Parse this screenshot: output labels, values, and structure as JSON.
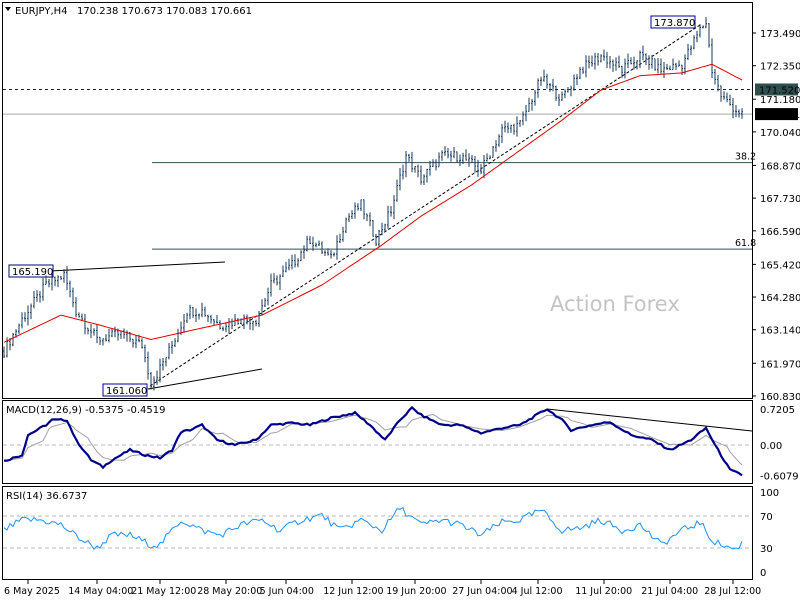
{
  "header": {
    "symbol": "EURJPY,H4",
    "ohlc": "170.238 170.673 170.083 170.661"
  },
  "watermark": "Action Forex",
  "colors": {
    "bars": "#1a3a5a",
    "ma": "#e00000",
    "macd": "#00008b",
    "signal": "#a0a0a0",
    "rsi": "#1e90ff"
  },
  "chart_data": [
    {
      "type": "line",
      "name": "price",
      "title": "EURJPY,H4",
      "bar_count": 247,
      "yticks": [
        "173.490",
        "172.350",
        "171.180",
        "170.040",
        "168.870",
        "167.730",
        "166.590",
        "165.420",
        "164.280",
        "163.140",
        "161.970",
        "160.830"
      ],
      "ytick_values": [
        173.49,
        172.35,
        171.18,
        170.04,
        168.87,
        167.73,
        166.59,
        165.42,
        164.28,
        163.14,
        161.97,
        160.83
      ],
      "ylim": [
        160.83,
        174.6
      ],
      "xticks": [
        {
          "label": "6 May 2025",
          "bar": 8
        },
        {
          "label": "14 May 04:00",
          "bar": 31
        },
        {
          "label": "21 May 12:00",
          "bar": 52
        },
        {
          "label": "28 May 20:00",
          "bar": 74
        },
        {
          "label": "5 Jun 04:00",
          "bar": 94
        },
        {
          "label": "12 Jun 12:00",
          "bar": 116
        },
        {
          "label": "19 Jun 20:00",
          "bar": 137
        },
        {
          "label": "27 Jun 04:00",
          "bar": 159
        },
        {
          "label": "4 Jul 12:00",
          "bar": 178
        },
        {
          "label": "11 Jul 20:00",
          "bar": 200
        },
        {
          "label": "21 Jul 04:00",
          "bar": 222
        },
        {
          "label": "28 Jul 12:00",
          "bar": 243
        }
      ],
      "close_path": [
        [
          0,
          162.4
        ],
        [
          6,
          163.5
        ],
        [
          14,
          164.7
        ],
        [
          20,
          165.05
        ],
        [
          24,
          163.8
        ],
        [
          31,
          162.8
        ],
        [
          39,
          163.0
        ],
        [
          46,
          162.6
        ],
        [
          49,
          161.3
        ],
        [
          51,
          161.6
        ],
        [
          56,
          162.6
        ],
        [
          61,
          163.8
        ],
        [
          66,
          163.8
        ],
        [
          72,
          163.3
        ],
        [
          79,
          163.5
        ],
        [
          84,
          163.5
        ],
        [
          89,
          164.7
        ],
        [
          96,
          165.4
        ],
        [
          102,
          166.3
        ],
        [
          109,
          165.6
        ],
        [
          114,
          167.0
        ],
        [
          119,
          167.5
        ],
        [
          124,
          166.3
        ],
        [
          129,
          167.3
        ],
        [
          134,
          169.2
        ],
        [
          139,
          168.4
        ],
        [
          146,
          169.2
        ],
        [
          152,
          169.2
        ],
        [
          159,
          168.7
        ],
        [
          166,
          170.1
        ],
        [
          172,
          170.3
        ],
        [
          179,
          171.9
        ],
        [
          186,
          171.2
        ],
        [
          192,
          172.2
        ],
        [
          199,
          172.7
        ],
        [
          206,
          172.2
        ],
        [
          212,
          172.7
        ],
        [
          219,
          172.2
        ],
        [
          226,
          172.4
        ],
        [
          232,
          173.6
        ],
        [
          234,
          173.87
        ],
        [
          236,
          172.2
        ],
        [
          239,
          171.3
        ],
        [
          244,
          170.8
        ],
        [
          246,
          170.661
        ]
      ],
      "ma_path": [
        [
          0,
          162.7
        ],
        [
          19,
          163.65
        ],
        [
          32,
          163.3
        ],
        [
          49,
          162.8
        ],
        [
          66,
          163.2
        ],
        [
          86,
          163.65
        ],
        [
          106,
          164.7
        ],
        [
          126,
          166.1
        ],
        [
          139,
          167.1
        ],
        [
          156,
          168.2
        ],
        [
          172,
          169.4
        ],
        [
          186,
          170.45
        ],
        [
          199,
          171.5
        ],
        [
          212,
          172.0
        ],
        [
          226,
          172.1
        ],
        [
          236,
          172.4
        ],
        [
          246,
          171.85
        ]
      ],
      "levels": {
        "dashed": "171.520",
        "last": "170.661",
        "fib382_label": "38.2",
        "fib382": 168.97,
        "fib618_label": "61.8",
        "fib618": 165.95
      },
      "annotations": {
        "high": "173.870",
        "swing_high": "165.190",
        "swing_low": "161.060"
      }
    },
    {
      "type": "line",
      "name": "macd",
      "title": "MACD(12,26,9) -0.5375 -0.4519",
      "yticks": [
        "0.7205",
        "0.00",
        "-0.6079"
      ],
      "ylim": [
        -0.7,
        0.88
      ],
      "macd_path": [
        [
          0,
          -0.32
        ],
        [
          6,
          -0.2
        ],
        [
          8,
          0.2
        ],
        [
          14,
          0.4
        ],
        [
          16,
          0.5
        ],
        [
          21,
          0.5
        ],
        [
          24,
          0.1
        ],
        [
          29,
          -0.3
        ],
        [
          33,
          -0.44
        ],
        [
          36,
          -0.3
        ],
        [
          42,
          -0.1
        ],
        [
          47,
          -0.2
        ],
        [
          52,
          -0.26
        ],
        [
          56,
          -0.1
        ],
        [
          59,
          0.26
        ],
        [
          62,
          0.3
        ],
        [
          66,
          0.4
        ],
        [
          71,
          0.1
        ],
        [
          77,
          0.0
        ],
        [
          84,
          0.1
        ],
        [
          89,
          0.4
        ],
        [
          96,
          0.44
        ],
        [
          102,
          0.4
        ],
        [
          109,
          0.54
        ],
        [
          117,
          0.64
        ],
        [
          122,
          0.4
        ],
        [
          127,
          0.1
        ],
        [
          132,
          0.5
        ],
        [
          136,
          0.74
        ],
        [
          139,
          0.6
        ],
        [
          146,
          0.4
        ],
        [
          152,
          0.4
        ],
        [
          159,
          0.24
        ],
        [
          166,
          0.34
        ],
        [
          172,
          0.4
        ],
        [
          181,
          0.72
        ],
        [
          186,
          0.5
        ],
        [
          189,
          0.3
        ],
        [
          196,
          0.4
        ],
        [
          202,
          0.46
        ],
        [
          209,
          0.2
        ],
        [
          216,
          0.1
        ],
        [
          222,
          -0.1
        ],
        [
          229,
          0.1
        ],
        [
          234,
          0.34
        ],
        [
          237,
          0.0
        ],
        [
          242,
          -0.5
        ],
        [
          246,
          -0.6
        ]
      ],
      "trendline": [
        [
          181,
          0.72
        ],
        [
          250,
          0.28
        ]
      ]
    },
    {
      "type": "line",
      "name": "rsi",
      "title": "RSI(14) 36.6737",
      "yticks": [
        "100",
        "70",
        "30",
        "0"
      ],
      "ylim": [
        0,
        100
      ],
      "rsi_path": [
        [
          0,
          52
        ],
        [
          6,
          65
        ],
        [
          12,
          65
        ],
        [
          19,
          59
        ],
        [
          26,
          40
        ],
        [
          31,
          30
        ],
        [
          36,
          46
        ],
        [
          42,
          46
        ],
        [
          49,
          34
        ],
        [
          52,
          34
        ],
        [
          59,
          65
        ],
        [
          66,
          52
        ],
        [
          72,
          46
        ],
        [
          79,
          59
        ],
        [
          86,
          65
        ],
        [
          92,
          52
        ],
        [
          99,
          65
        ],
        [
          106,
          71
        ],
        [
          112,
          52
        ],
        [
          119,
          65
        ],
        [
          126,
          52
        ],
        [
          132,
          80
        ],
        [
          139,
          59
        ],
        [
          146,
          65
        ],
        [
          152,
          59
        ],
        [
          159,
          46
        ],
        [
          166,
          62
        ],
        [
          172,
          65
        ],
        [
          179,
          77
        ],
        [
          186,
          52
        ],
        [
          192,
          55
        ],
        [
          199,
          65
        ],
        [
          206,
          52
        ],
        [
          212,
          59
        ],
        [
          219,
          34
        ],
        [
          226,
          52
        ],
        [
          232,
          62
        ],
        [
          236,
          40
        ],
        [
          239,
          34
        ],
        [
          244,
          28
        ],
        [
          246,
          36.7
        ]
      ]
    }
  ]
}
